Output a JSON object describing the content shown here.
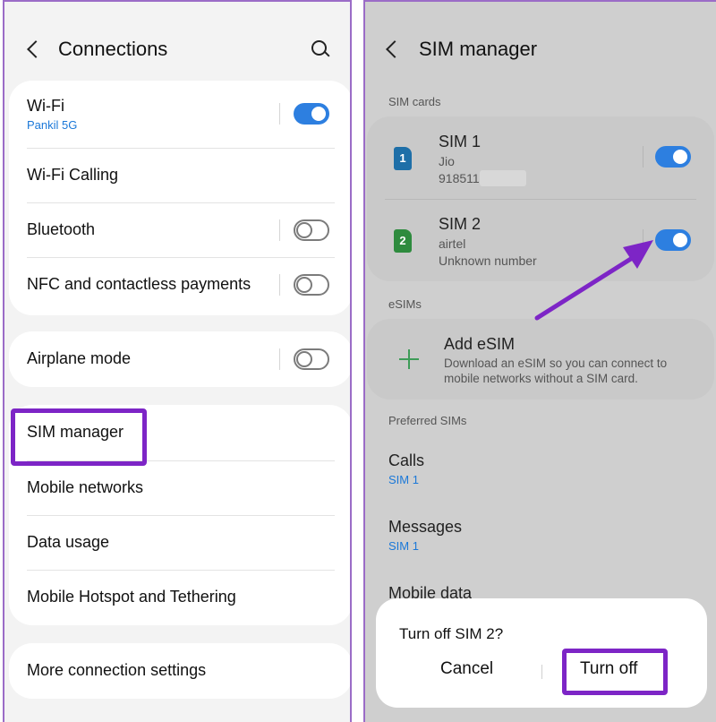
{
  "left": {
    "header": {
      "title": "Connections"
    },
    "items": {
      "wifi": {
        "label": "Wi-Fi",
        "sub": "Pankil 5G",
        "toggle": "on"
      },
      "wifi_calling": {
        "label": "Wi-Fi Calling"
      },
      "bluetooth": {
        "label": "Bluetooth",
        "toggle": "off"
      },
      "nfc": {
        "label": "NFC and contactless payments",
        "toggle": "off"
      },
      "airplane": {
        "label": "Airplane mode",
        "toggle": "off"
      },
      "sim_manager": {
        "label": "SIM manager"
      },
      "mobile_networks": {
        "label": "Mobile networks"
      },
      "data_usage": {
        "label": "Data usage"
      },
      "hotspot": {
        "label": "Mobile Hotspot and Tethering"
      },
      "more": {
        "label": "More connection settings"
      }
    }
  },
  "right": {
    "header": {
      "title": "SIM manager"
    },
    "sections": {
      "sim_cards": "SIM cards",
      "esims": "eSIMs",
      "preferred": "Preferred SIMs"
    },
    "sims": [
      {
        "icon": "1",
        "name": "SIM 1",
        "carrier": "Jio",
        "number": "918511",
        "toggle": "on",
        "color": "#1e6fa8"
      },
      {
        "icon": "2",
        "name": "SIM 2",
        "carrier": "airtel",
        "number": "Unknown number",
        "toggle": "on",
        "color": "#2e8b3e"
      }
    ],
    "esim": {
      "title": "Add eSIM",
      "desc_line1": "Download an eSIM so you can connect to",
      "desc_line2": "mobile networks without a SIM card."
    },
    "preferred": {
      "calls": {
        "title": "Calls",
        "value": "SIM 1"
      },
      "messages": {
        "title": "Messages",
        "value": "SIM 1"
      },
      "mobile_data": {
        "title": "Mobile data"
      }
    },
    "dialog": {
      "title": "Turn off SIM 2?",
      "cancel": "Cancel",
      "confirm": "Turn off"
    }
  },
  "colors": {
    "accent": "#2d7fe0",
    "highlight": "#7d25c6",
    "link": "#1b78d8"
  }
}
